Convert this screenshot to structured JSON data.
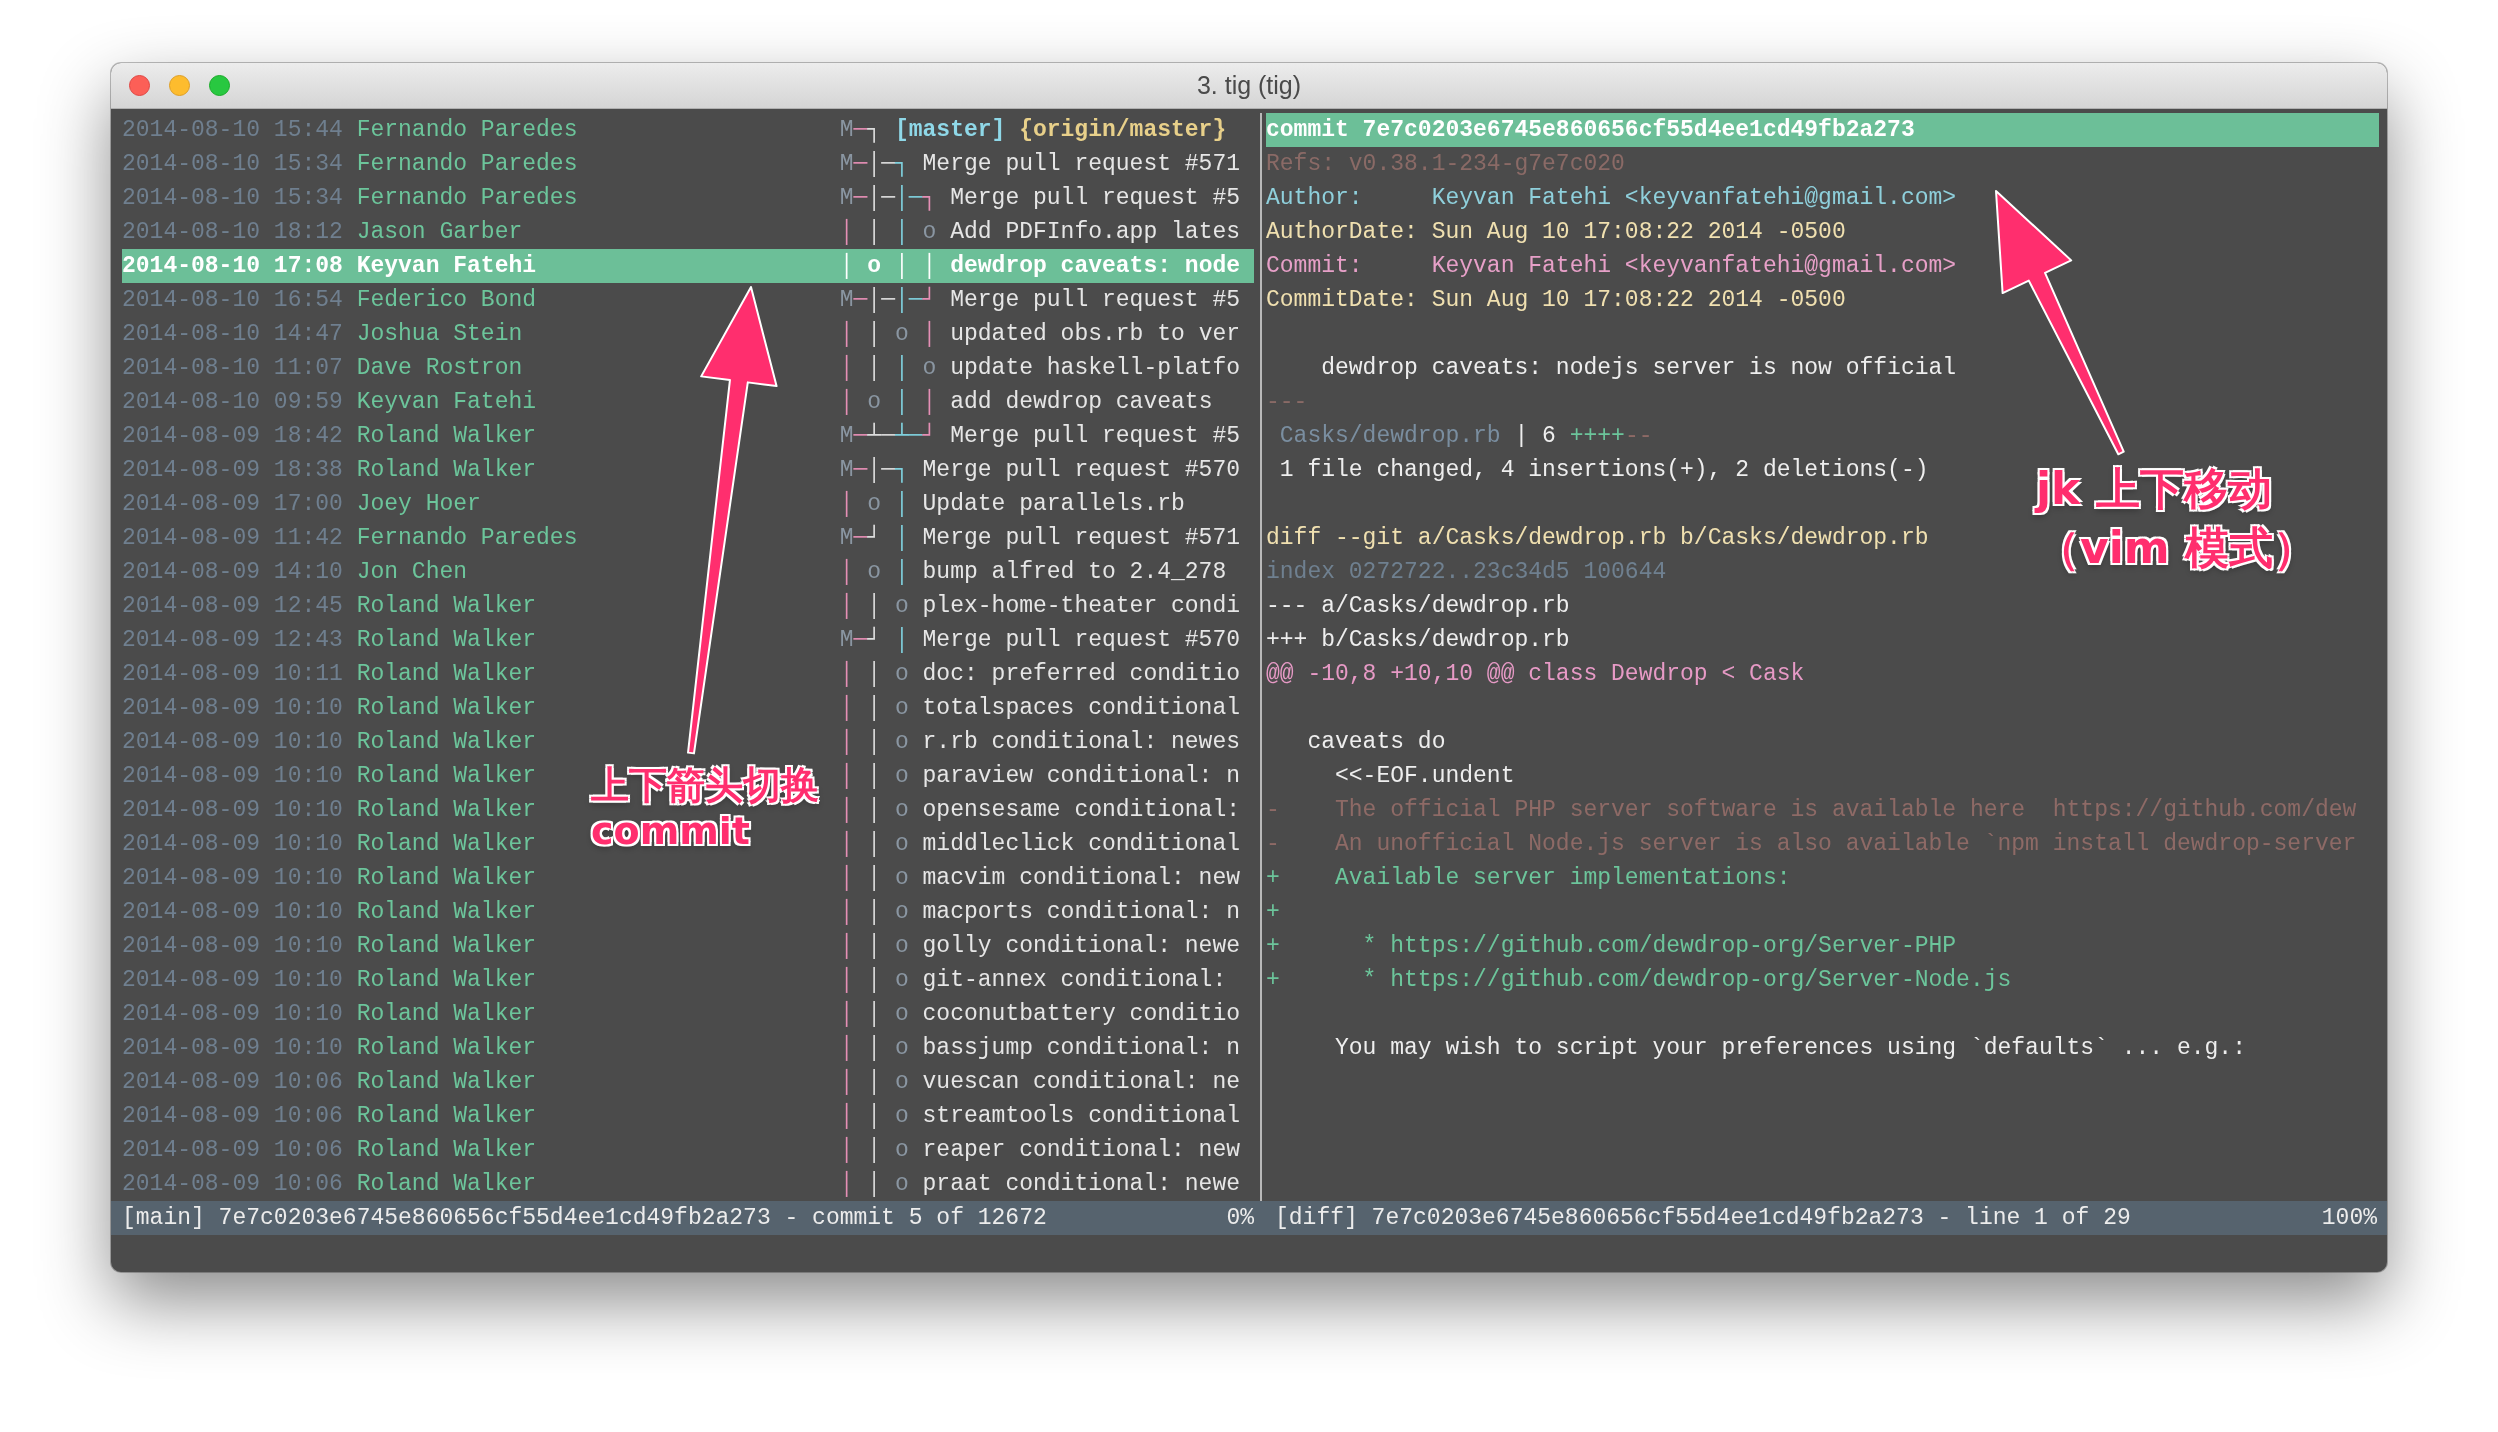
{
  "window": {
    "title": "3. tig (tig)"
  },
  "log": {
    "rows": [
      {
        "date": "2014-08-10 15:44",
        "author": "Fernando Paredes",
        "graph": "M─┐",
        "refs": [
          {
            "name": "[master]",
            "kind": "local"
          },
          {
            "name": "{origin/master}",
            "kind": "remote"
          }
        ],
        "selected": false
      },
      {
        "date": "2014-08-10 15:34",
        "author": "Fernando Paredes",
        "graph": "M─│─┐",
        "message": "Merge pull request #571",
        "selected": false
      },
      {
        "date": "2014-08-10 15:34",
        "author": "Fernando Paredes",
        "graph": "M─│─│─┐",
        "message": "Merge pull request #5",
        "selected": false
      },
      {
        "date": "2014-08-10 18:12",
        "author": "Jason Garber",
        "graph": "│ │ │ o",
        "message": "Add PDFInfo.app lates",
        "selected": false
      },
      {
        "date": "2014-08-10 17:08",
        "author": "Keyvan Fatehi",
        "graph": "│ o │ │",
        "message": "dewdrop caveats: node",
        "selected": true
      },
      {
        "date": "2014-08-10 16:54",
        "author": "Federico Bond",
        "graph": "M─│─│─┘",
        "message": "Merge pull request #5",
        "selected": false
      },
      {
        "date": "2014-08-10 14:47",
        "author": "Joshua Stein",
        "graph": "│ │ o │",
        "message": "updated obs.rb to ver",
        "selected": false
      },
      {
        "date": "2014-08-10 11:07",
        "author": "Dave Rostron",
        "graph": "│ │ │ o",
        "message": "update haskell-platfo",
        "selected": false
      },
      {
        "date": "2014-08-10 09:59",
        "author": "Keyvan Fatehi",
        "graph": "│ o │ │",
        "message": "add dewdrop caveats",
        "selected": false
      },
      {
        "date": "2014-08-09 18:42",
        "author": "Roland Walker",
        "graph": "M─┴─┴─┘",
        "message": "Merge pull request #5",
        "selected": false
      },
      {
        "date": "2014-08-09 18:38",
        "author": "Roland Walker",
        "graph": "M─│─┐",
        "message": "Merge pull request #570",
        "selected": false
      },
      {
        "date": "2014-08-09 17:00",
        "author": "Joey Hoer",
        "graph": "│ o │",
        "message": "Update parallels.rb",
        "selected": false
      },
      {
        "date": "2014-08-09 11:42",
        "author": "Fernando Paredes",
        "graph": "M─┘ │",
        "message": "Merge pull request #571",
        "selected": false
      },
      {
        "date": "2014-08-09 14:10",
        "author": "Jon Chen",
        "graph": "│ o │",
        "message": "bump alfred to 2.4_278",
        "selected": false
      },
      {
        "date": "2014-08-09 12:45",
        "author": "Roland Walker",
        "graph": "│ │ o",
        "message": "plex-home-theater condi",
        "selected": false
      },
      {
        "date": "2014-08-09 12:43",
        "author": "Roland Walker",
        "graph": "M─┘ │",
        "message": "Merge pull request #570",
        "selected": false
      },
      {
        "date": "2014-08-09 10:11",
        "author": "Roland Walker",
        "graph": "│ │ o",
        "message": "doc: preferred conditio",
        "selected": false
      },
      {
        "date": "2014-08-09 10:10",
        "author": "Roland Walker",
        "graph": "│ │ o",
        "message": "totalspaces conditional",
        "selected": false
      },
      {
        "date": "2014-08-09 10:10",
        "author": "Roland Walker",
        "graph": "│ │ o",
        "message": "r.rb conditional: newes",
        "selected": false
      },
      {
        "date": "2014-08-09 10:10",
        "author": "Roland Walker",
        "graph": "│ │ o",
        "message": "paraview conditional: n",
        "selected": false
      },
      {
        "date": "2014-08-09 10:10",
        "author": "Roland Walker",
        "graph": "│ │ o",
        "message": "opensesame conditional:",
        "selected": false
      },
      {
        "date": "2014-08-09 10:10",
        "author": "Roland Walker",
        "graph": "│ │ o",
        "message": "middleclick conditional",
        "selected": false
      },
      {
        "date": "2014-08-09 10:10",
        "author": "Roland Walker",
        "graph": "│ │ o",
        "message": "macvim conditional: new",
        "selected": false
      },
      {
        "date": "2014-08-09 10:10",
        "author": "Roland Walker",
        "graph": "│ │ o",
        "message": "macports conditional: n",
        "selected": false
      },
      {
        "date": "2014-08-09 10:10",
        "author": "Roland Walker",
        "graph": "│ │ o",
        "message": "golly conditional: newe",
        "selected": false
      },
      {
        "date": "2014-08-09 10:10",
        "author": "Roland Walker",
        "graph": "│ │ o",
        "message": "git-annex conditional:",
        "selected": false
      },
      {
        "date": "2014-08-09 10:10",
        "author": "Roland Walker",
        "graph": "│ │ o",
        "message": "coconutbattery conditio",
        "selected": false
      },
      {
        "date": "2014-08-09 10:10",
        "author": "Roland Walker",
        "graph": "│ │ o",
        "message": "bassjump conditional: n",
        "selected": false
      },
      {
        "date": "2014-08-09 10:06",
        "author": "Roland Walker",
        "graph": "│ │ o",
        "message": "vuescan conditional: ne",
        "selected": false
      },
      {
        "date": "2014-08-09 10:06",
        "author": "Roland Walker",
        "graph": "│ │ o",
        "message": "streamtools conditional",
        "selected": false
      },
      {
        "date": "2014-08-09 10:06",
        "author": "Roland Walker",
        "graph": "│ │ o",
        "message": "reaper conditional: new",
        "selected": false
      },
      {
        "date": "2014-08-09 10:06",
        "author": "Roland Walker",
        "graph": "│ │ o",
        "message": "praat conditional: newe",
        "selected": false
      }
    ],
    "status": {
      "text": "[main] 7e7c0203e6745e860656cf55d4ee1cd49fb2a273 - commit 5 of 12672",
      "percent": "0%"
    }
  },
  "diff": {
    "lines": [
      {
        "kind": "commit",
        "text": "commit 7e7c0203e6745e860656cf55d4ee1cd49fb2a273"
      },
      {
        "kind": "refs",
        "text": "Refs: v0.38.1-234-g7e7c020"
      },
      {
        "kind": "author",
        "text": "Author:     Keyvan Fatehi <keyvanfatehi@gmail.com>"
      },
      {
        "kind": "date",
        "text": "AuthorDate: Sun Aug 10 17:08:22 2014 -0500"
      },
      {
        "kind": "committer",
        "text": "Commit:     Keyvan Fatehi <keyvanfatehi@gmail.com>"
      },
      {
        "kind": "date",
        "text": "CommitDate: Sun Aug 10 17:08:22 2014 -0500"
      },
      {
        "kind": "blank"
      },
      {
        "kind": "message",
        "text": "    dewdrop caveats: nodejs server is now official"
      },
      {
        "kind": "separator",
        "text": "---"
      },
      {
        "kind": "stat",
        "file": " Casks/dewdrop.rb",
        "count": " | 6 ",
        "plus": "++++",
        "minus": "--"
      },
      {
        "kind": "context",
        "text": " 1 file changed, 4 insertions(+), 2 deletions(-)"
      },
      {
        "kind": "blank"
      },
      {
        "kind": "diff",
        "text": "diff --git a/Casks/dewdrop.rb b/Casks/dewdrop.rb"
      },
      {
        "kind": "index",
        "text": "index 0272722..23c34d5 100644"
      },
      {
        "kind": "context",
        "text": "--- a/Casks/dewdrop.rb"
      },
      {
        "kind": "context",
        "text": "+++ b/Casks/dewdrop.rb"
      },
      {
        "kind": "hunk",
        "text": "@@ -10,8 +10,10 @@ class Dewdrop < Cask"
      },
      {
        "kind": "blank"
      },
      {
        "kind": "context",
        "text": "   caveats do"
      },
      {
        "kind": "context",
        "text": "     <<-EOF.undent"
      },
      {
        "kind": "removed",
        "text": "-    The official PHP server software is available here  https://github.com/dew"
      },
      {
        "kind": "removed",
        "text": "-    An unofficial Node.js server is also available `npm install dewdrop-server"
      },
      {
        "kind": "added",
        "text": "+    Available server implementations:"
      },
      {
        "kind": "added",
        "text": "+"
      },
      {
        "kind": "added",
        "text": "+      * https://github.com/dewdrop-org/Server-PHP"
      },
      {
        "kind": "added",
        "text": "+      * https://github.com/dewdrop-org/Server-Node.js"
      },
      {
        "kind": "blank"
      },
      {
        "kind": "context",
        "text": "     You may wish to script your preferences using `defaults` ... e.g.:"
      }
    ],
    "status": {
      "text": "[diff] 7e7c0203e6745e860656cf55d4ee1cd49fb2a273 - line 1 of 29",
      "percent": "100%"
    }
  },
  "annotations": [
    {
      "kind": "left",
      "lines": [
        "上下箭头切换 commit"
      ]
    },
    {
      "kind": "right",
      "lines": [
        "jk 上下移动",
        "（vim 模式）"
      ]
    }
  ]
}
